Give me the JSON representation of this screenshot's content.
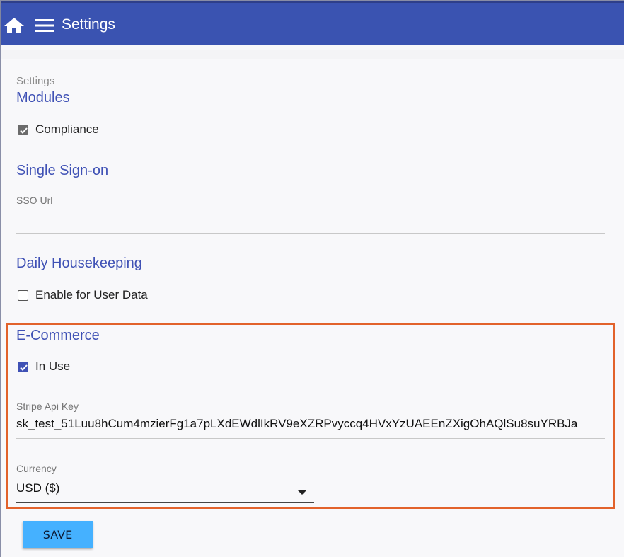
{
  "header": {
    "title": "Settings",
    "background": "#3a53b1"
  },
  "breadcrumb": "Settings",
  "modules": {
    "title": "Modules",
    "compliance": {
      "label": "Compliance",
      "checked": true
    }
  },
  "sso": {
    "title": "Single Sign-on",
    "url_label": "SSO Url",
    "url_value": ""
  },
  "housekeeping": {
    "title": "Daily Housekeeping",
    "user_data": {
      "label": "Enable for User Data",
      "checked": false
    }
  },
  "ecommerce": {
    "title": "E-Commerce",
    "in_use": {
      "label": "In Use",
      "checked": true
    },
    "stripe_label": "Stripe Api Key",
    "stripe_value": "sk_test_51Luu8hCum4mzierFg1a7pLXdEWdlIkRV9eXZRPvyccq4HVxYzUAEEnZXigOhAQlSu8suYRBJa",
    "currency_label": "Currency",
    "currency_value": "USD ($)",
    "highlight_color": "#e2622b"
  },
  "actions": {
    "save_label": "SAVE",
    "save_color": "#45b1ff"
  },
  "icons": {
    "home": "home-icon",
    "menu": "hamburger-menu-icon",
    "dropdown": "dropdown-arrow-icon"
  }
}
